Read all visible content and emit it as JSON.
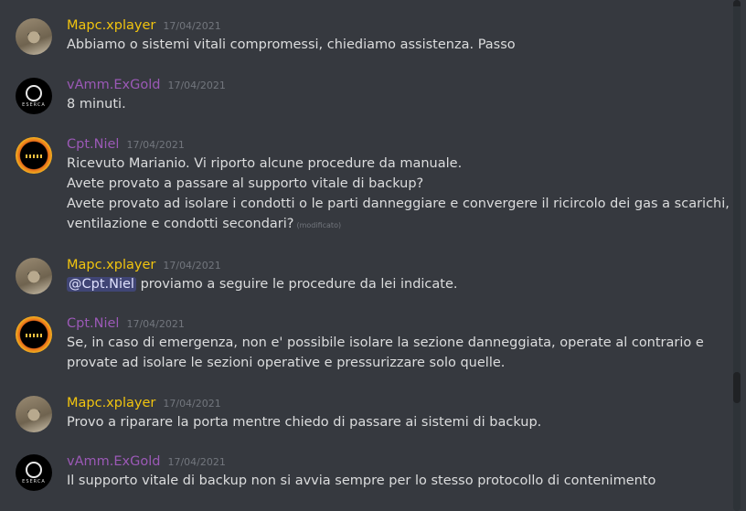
{
  "messages": [
    {
      "author": "Mapc.xplayer",
      "time": "17/04/2021",
      "avatar": "cat-avatar",
      "lines": [
        "Abbiamo o sistemi vitali compromessi, chiediamo assistenza. Passo"
      ]
    },
    {
      "author": "vAmm.ExGold",
      "time": "17/04/2021",
      "avatar": "astronaut-avatar",
      "avatar_text": "ESERCA",
      "lines": [
        "8 minuti."
      ]
    },
    {
      "author": "Cpt.Niel",
      "time": "17/04/2021",
      "avatar": "ring-avatar",
      "lines": [
        "Ricevuto Marianio. Vi riporto alcune procedure da manuale.",
        "Avete provato a passare al supporto vitale di backup?",
        "Avete provato ad isolare i condotti o le parti danneggiare e convergere il ricircolo dei gas a scarichi,",
        "ventilazione e condotti secondari?"
      ],
      "edited": "(modificato)"
    },
    {
      "author": "Mapc.xplayer",
      "time": "17/04/2021",
      "avatar": "cat-avatar",
      "mention": "@Cpt.Niel",
      "lines": [
        "proviamo a seguire le procedure da lei indicate."
      ]
    },
    {
      "author": "Cpt.Niel",
      "time": "17/04/2021",
      "avatar": "ring-avatar",
      "lines": [
        "Se, in caso di emergenza, non e' possibile isolare la sezione danneggiata, operate al contrario e",
        "provate ad isolare le sezioni operative e pressurizzare solo quelle."
      ]
    },
    {
      "author": "Mapc.xplayer",
      "time": "17/04/2021",
      "avatar": "cat-avatar",
      "lines": [
        "Provo a riparare la porta mentre chiedo di passare ai sistemi di backup."
      ]
    },
    {
      "author": "vAmm.ExGold",
      "time": "17/04/2021",
      "avatar": "astronaut-avatar",
      "avatar_text": "ESERCA",
      "lines": [
        "Il supporto vitale di backup non si avvia sempre per lo stesso protocollo di contenimento"
      ]
    }
  ],
  "colors": {
    "gold_name": "#f1c40f",
    "purple_name": "#9b59b6",
    "background": "#36393f"
  }
}
